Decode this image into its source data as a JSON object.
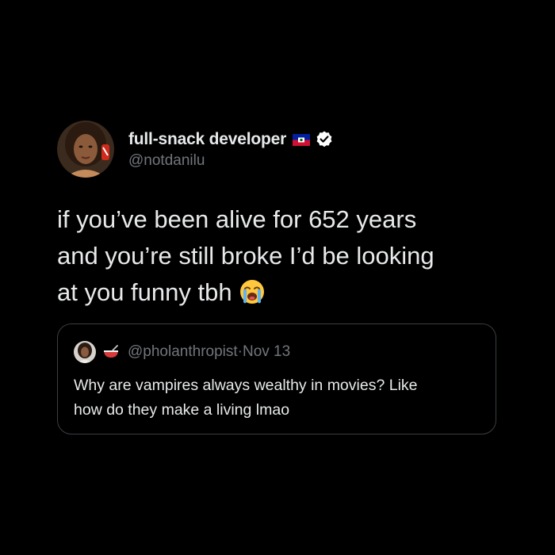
{
  "author": {
    "display_name": "full-snack developer",
    "handle": "@notdanilu",
    "flag_icon": "haiti-flag-icon",
    "verified_icon": "verified-badge-icon"
  },
  "tweet": {
    "lines": [
      "if you’ve been alive for 652 years",
      "and you’re still broke I’d be looking",
      "at you funny tbh"
    ],
    "emoji": "loudly-crying-face-emoji"
  },
  "quote": {
    "avatar_icon": "profile-avatar",
    "emoji": "bowl-with-spoon-emoji",
    "handle": "@pholanthropist",
    "separator": "·",
    "date": "Nov 13",
    "lines": [
      "Why are vampires always wealthy in movies? Like",
      "how do they make a living lmao"
    ]
  },
  "colors": {
    "background": "#000000",
    "primary_text": "#e7e9ea",
    "secondary_text": "#71767b",
    "border": "#3a3d41",
    "verified_badge": "#ffffff"
  }
}
